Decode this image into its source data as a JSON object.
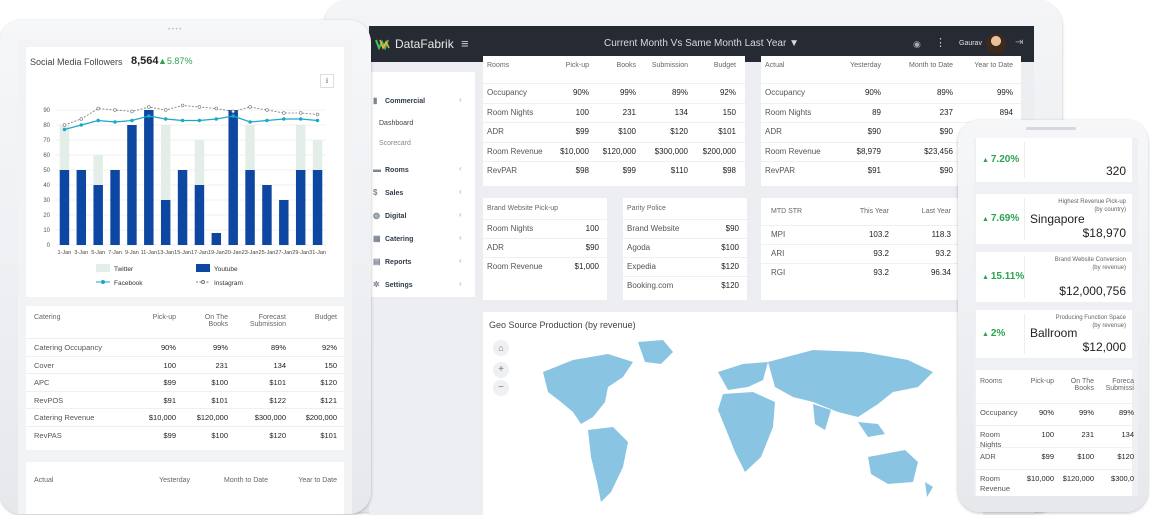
{
  "laptop": {
    "logo": "DataFabrik",
    "title": "Current Month Vs Same Month Last Year",
    "user": "Gaurav",
    "nav": [
      {
        "label": "Commercial",
        "icon": "bar-chart-icon"
      },
      {
        "label": "Rooms",
        "icon": "bed-icon"
      },
      {
        "label": "Sales",
        "icon": "dollar-icon"
      },
      {
        "label": "Digital",
        "icon": "globe-icon"
      },
      {
        "label": "Catering",
        "icon": "calendar-icon"
      },
      {
        "label": "Reports",
        "icon": "report-icon"
      },
      {
        "label": "Settings",
        "icon": "gear-icon"
      }
    ],
    "subnav": [
      "Dashboard",
      "Scorecard"
    ],
    "rooms_table": {
      "headers": [
        "Rooms",
        "Pick-up",
        "Books",
        "Submission",
        "Budget"
      ],
      "rows": [
        [
          "Occupancy",
          "90%",
          "99%",
          "89%",
          "92%"
        ],
        [
          "Room Nights",
          "100",
          "231",
          "134",
          "150"
        ],
        [
          "ADR",
          "$99",
          "$100",
          "$120",
          "$101"
        ],
        [
          "Room Revenue",
          "$10,000",
          "$120,000",
          "$300,000",
          "$200,000"
        ],
        [
          "RevPAR",
          "$98",
          "$99",
          "$110",
          "$98"
        ]
      ]
    },
    "actual_table": {
      "headers": [
        "Actual",
        "Yesterday",
        "Month to Date",
        "Year to Date"
      ],
      "rows": [
        [
          "Occupancy",
          "90%",
          "89%",
          "99%"
        ],
        [
          "Room Nights",
          "89",
          "237",
          "894"
        ],
        [
          "ADR",
          "$90",
          "$90",
          "$88"
        ],
        [
          "Room Revenue",
          "$8,979",
          "$23,456",
          ""
        ],
        [
          "RevPAR",
          "$91",
          "$90",
          "$88"
        ]
      ]
    },
    "brand_pickup": {
      "title": "Brand Website Pick-up",
      "rows": [
        [
          "Room Nights",
          "100"
        ],
        [
          "ADR",
          "$90"
        ],
        [
          "Room Revenue",
          "$1,000"
        ]
      ]
    },
    "parity": {
      "title": "Parity Police",
      "rows": [
        [
          "Brand Website",
          "$90"
        ],
        [
          "Agoda",
          "$100"
        ],
        [
          "Expedia",
          "$120"
        ],
        [
          "Booking.com",
          "$120"
        ]
      ]
    },
    "mtd": {
      "headers": [
        "MTD STR",
        "This Year",
        "Last Year"
      ],
      "rows": [
        [
          "MPI",
          "103.2",
          "118.3"
        ],
        [
          "ARI",
          "93.2",
          "93.2"
        ],
        [
          "RGI",
          "93.2",
          "96.34"
        ]
      ]
    },
    "geo_title": "Geo Source Production (by revenue)"
  },
  "tablet": {
    "chart_data": {
      "type": "bar",
      "title": "Social Media Followers",
      "total": "8,564",
      "change": "5.87%",
      "categories": [
        "1-Jan",
        "3-Jan",
        "5-Jan",
        "7-Jan",
        "9-Jan",
        "11-Jan",
        "13-Jan",
        "15-Jan",
        "17-Jan",
        "19-Jan",
        "20-Jan",
        "23-Jan",
        "25-Jan",
        "27-Jan",
        "29-Jan",
        "31-Jan"
      ],
      "yticks": [
        "0",
        "10",
        "20",
        "30",
        "40",
        "50",
        "60",
        "70",
        "80",
        "90"
      ],
      "ylim": [
        0,
        100
      ],
      "series": [
        {
          "name": "Twitter",
          "type": "bar",
          "color": "#e3eee9",
          "values": [
            80,
            50,
            60,
            50,
            20,
            80,
            80,
            50,
            70,
            0,
            80,
            80,
            20,
            20,
            80,
            70
          ]
        },
        {
          "name": "Youtube",
          "type": "bar",
          "color": "#0d47a1",
          "values": [
            50,
            50,
            40,
            50,
            80,
            90,
            30,
            50,
            40,
            8,
            90,
            50,
            40,
            30,
            50,
            50
          ]
        },
        {
          "name": "Facebook",
          "type": "line",
          "color": "#1aa7c9",
          "values": [
            77,
            80,
            83,
            82,
            83,
            86,
            84,
            83,
            83,
            84,
            86,
            82,
            83,
            84,
            84,
            83
          ]
        },
        {
          "name": "Instagram",
          "type": "line",
          "color": "#777777",
          "values": [
            80,
            84,
            91,
            90,
            89,
            92,
            90,
            93,
            92,
            91,
            89,
            92,
            90,
            88,
            88,
            87
          ]
        }
      ]
    },
    "catering_table": {
      "headers": [
        "Catering",
        "Pick-up",
        "On The Books",
        "Forecast Submission",
        "Budget"
      ],
      "rows": [
        [
          "Catering Occupancy",
          "90%",
          "99%",
          "89%",
          "92%"
        ],
        [
          "Cover",
          "100",
          "231",
          "134",
          "150"
        ],
        [
          "APC",
          "$99",
          "$100",
          "$101",
          "$120"
        ],
        [
          "RevPOS",
          "$91",
          "$101",
          "$122",
          "$121"
        ],
        [
          "Catering Revenue",
          "$10,000",
          "$120,000",
          "$300,000",
          "$200,000"
        ],
        [
          "RevPAS",
          "$99",
          "$100",
          "$120",
          "$101"
        ]
      ]
    },
    "actual_headers": [
      "Actual",
      "Yesterday",
      "Month to Date",
      "Year to Date"
    ]
  },
  "phone": {
    "kpis": [
      {
        "change": "7.20%",
        "label": "",
        "sub": "",
        "value": "320"
      },
      {
        "change": "7.69%",
        "label": "Highest Revenue Pick-up",
        "sub": "(by country)",
        "name": "Singapore",
        "value": "$18,970"
      },
      {
        "change": "15.11%",
        "label": "Brand Website Conversion",
        "sub": "(by revenue)",
        "value": "$12,000,756"
      },
      {
        "change": "2%",
        "label": "Producing Function Space",
        "sub": "(by revenue)",
        "name": "Ballroom",
        "value": "$12,000"
      }
    ],
    "table": {
      "headers": [
        "Rooms",
        "Pick-up",
        "On The Books",
        "Foreca Submissi"
      ],
      "rows": [
        [
          "Occupancy",
          "90%",
          "99%",
          "89%"
        ],
        [
          "Room Nights",
          "100",
          "231",
          "134"
        ],
        [
          "ADR",
          "$99",
          "$100",
          "$120"
        ],
        [
          "Room Revenue",
          "$10,000",
          "$120,000",
          "$300,0"
        ]
      ]
    }
  }
}
